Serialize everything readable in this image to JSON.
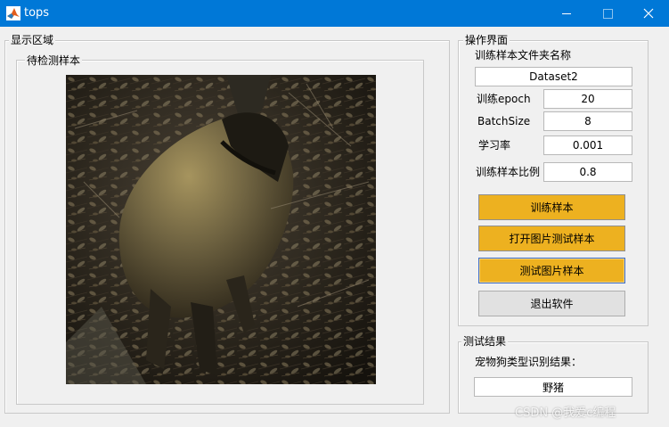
{
  "window": {
    "title": "tops",
    "controls": {
      "minimize": "minimize",
      "maximize": "maximize",
      "close": "close"
    }
  },
  "display_area": {
    "legend": "显示区域",
    "sample_panel": {
      "legend": "待检测样本",
      "image": "wild-boar-photo"
    }
  },
  "operation": {
    "legend": "操作界面",
    "folder_label": "训练样本文件夹名称",
    "folder_value": "Dataset2",
    "epoch_label": "训练epoch",
    "epoch_value": "20",
    "batch_label": "BatchSize",
    "batch_value": "8",
    "lr_label": "学习率",
    "lr_value": "0.001",
    "ratio_label": "训练样本比例",
    "ratio_value": "0.8",
    "buttons": {
      "train": "训练样本",
      "open_image": "打开图片测试样本",
      "test_image": "测试图片样本",
      "exit": "退出软件"
    }
  },
  "result": {
    "legend": "测试结果",
    "label": "宠物狗类型识别结果：",
    "value": "野猪"
  },
  "watermark": "CSDN @我爱c编程",
  "colors": {
    "titlebar": "#0078d7",
    "button_accent": "#edb120",
    "button_neutral": "#e1e1e1",
    "background": "#f0f0f0"
  }
}
